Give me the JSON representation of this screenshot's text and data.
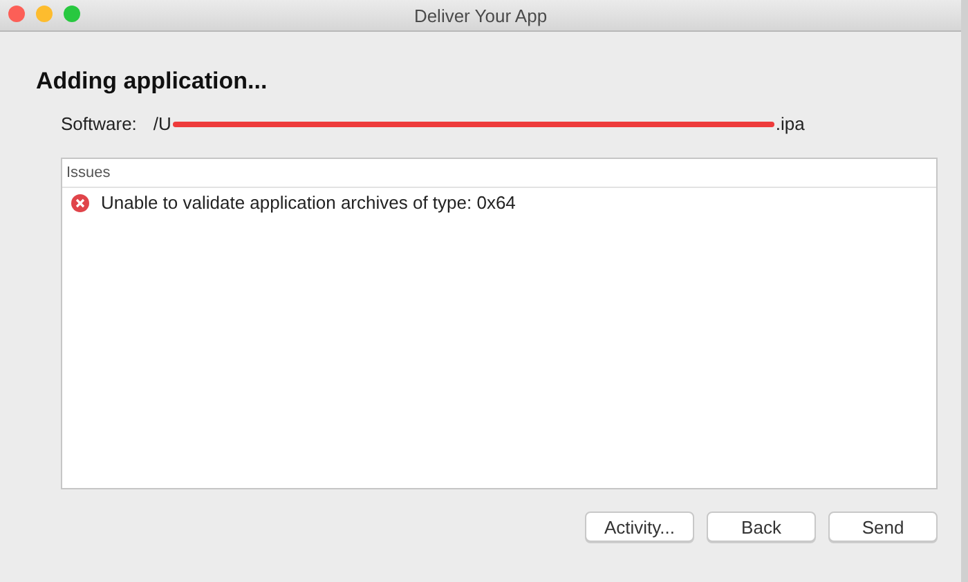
{
  "window": {
    "title": "Deliver Your App"
  },
  "heading": "Adding application...",
  "software": {
    "label": "Software:",
    "path_start": "/U",
    "path_end": ".ipa",
    "redacted": true
  },
  "issues": {
    "header": "Issues",
    "rows": [
      {
        "kind": "error",
        "message": "Unable to validate application archives of type: 0x64"
      }
    ]
  },
  "buttons": [
    "Activity...",
    "Back",
    "Send"
  ]
}
